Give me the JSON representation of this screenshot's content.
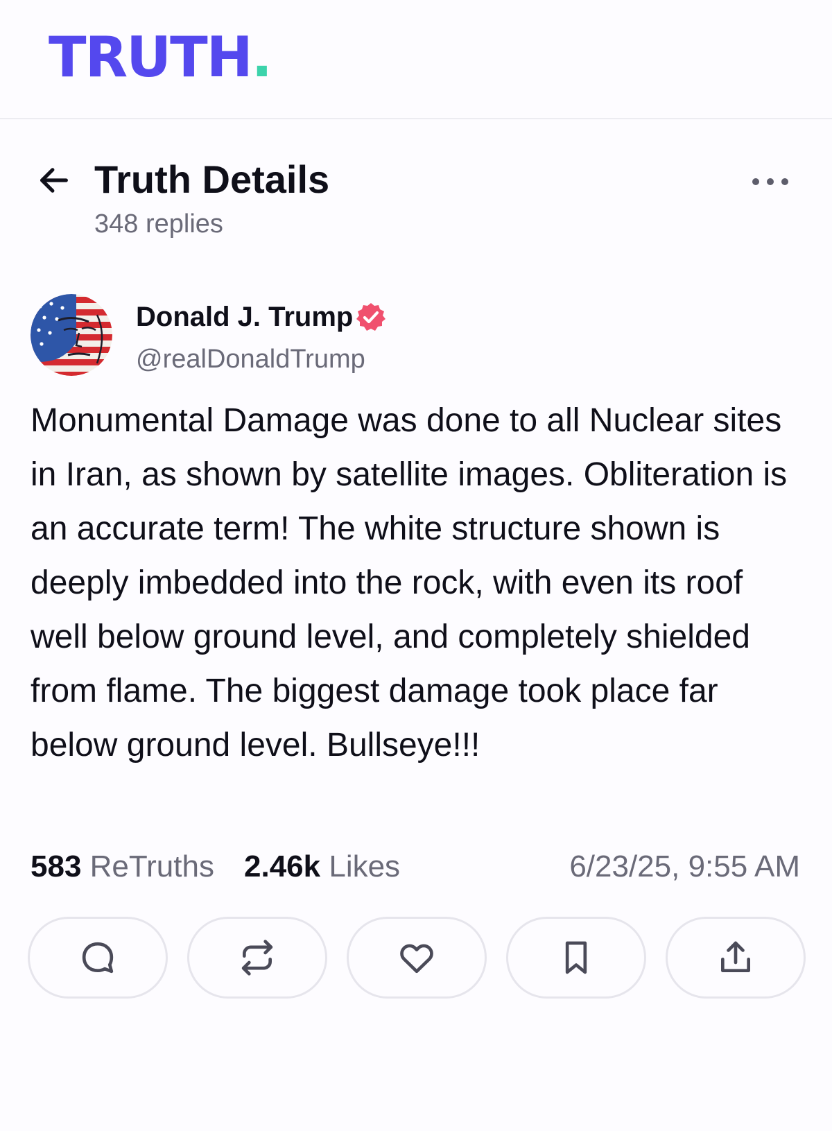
{
  "brand": {
    "logo_text": "TRUTH",
    "logo_dot": ".",
    "primary_color": "#5448ee",
    "accent_color": "#3cd3ab",
    "verified_color": "#f0506e"
  },
  "header": {
    "back_icon": "arrow-left-icon",
    "title": "Truth Details",
    "reply_count": "348 replies",
    "more_icon": "more-horizontal-icon"
  },
  "post": {
    "author_name": "Donald J. Trump",
    "author_handle": "@realDonaldTrump",
    "verified_icon": "verified-badge-icon",
    "text": "Monumental Damage was done to all Nuclear sites in Iran, as shown by satellite images. Obliteration is an accurate term! The white structure shown is deeply imbedded into the rock, with even its roof well below ground level, and completely shielded from flame. The biggest damage took place far below ground level. Bullseye!!!",
    "retruths_count": "583",
    "retruths_label": "ReTruths",
    "likes_count": "2.46k",
    "likes_label": "Likes",
    "timestamp": "6/23/25, 9:55 AM"
  },
  "actions": [
    {
      "icon": "reply-icon"
    },
    {
      "icon": "retruth-icon"
    },
    {
      "icon": "like-icon"
    },
    {
      "icon": "bookmark-icon"
    },
    {
      "icon": "share-icon"
    }
  ]
}
